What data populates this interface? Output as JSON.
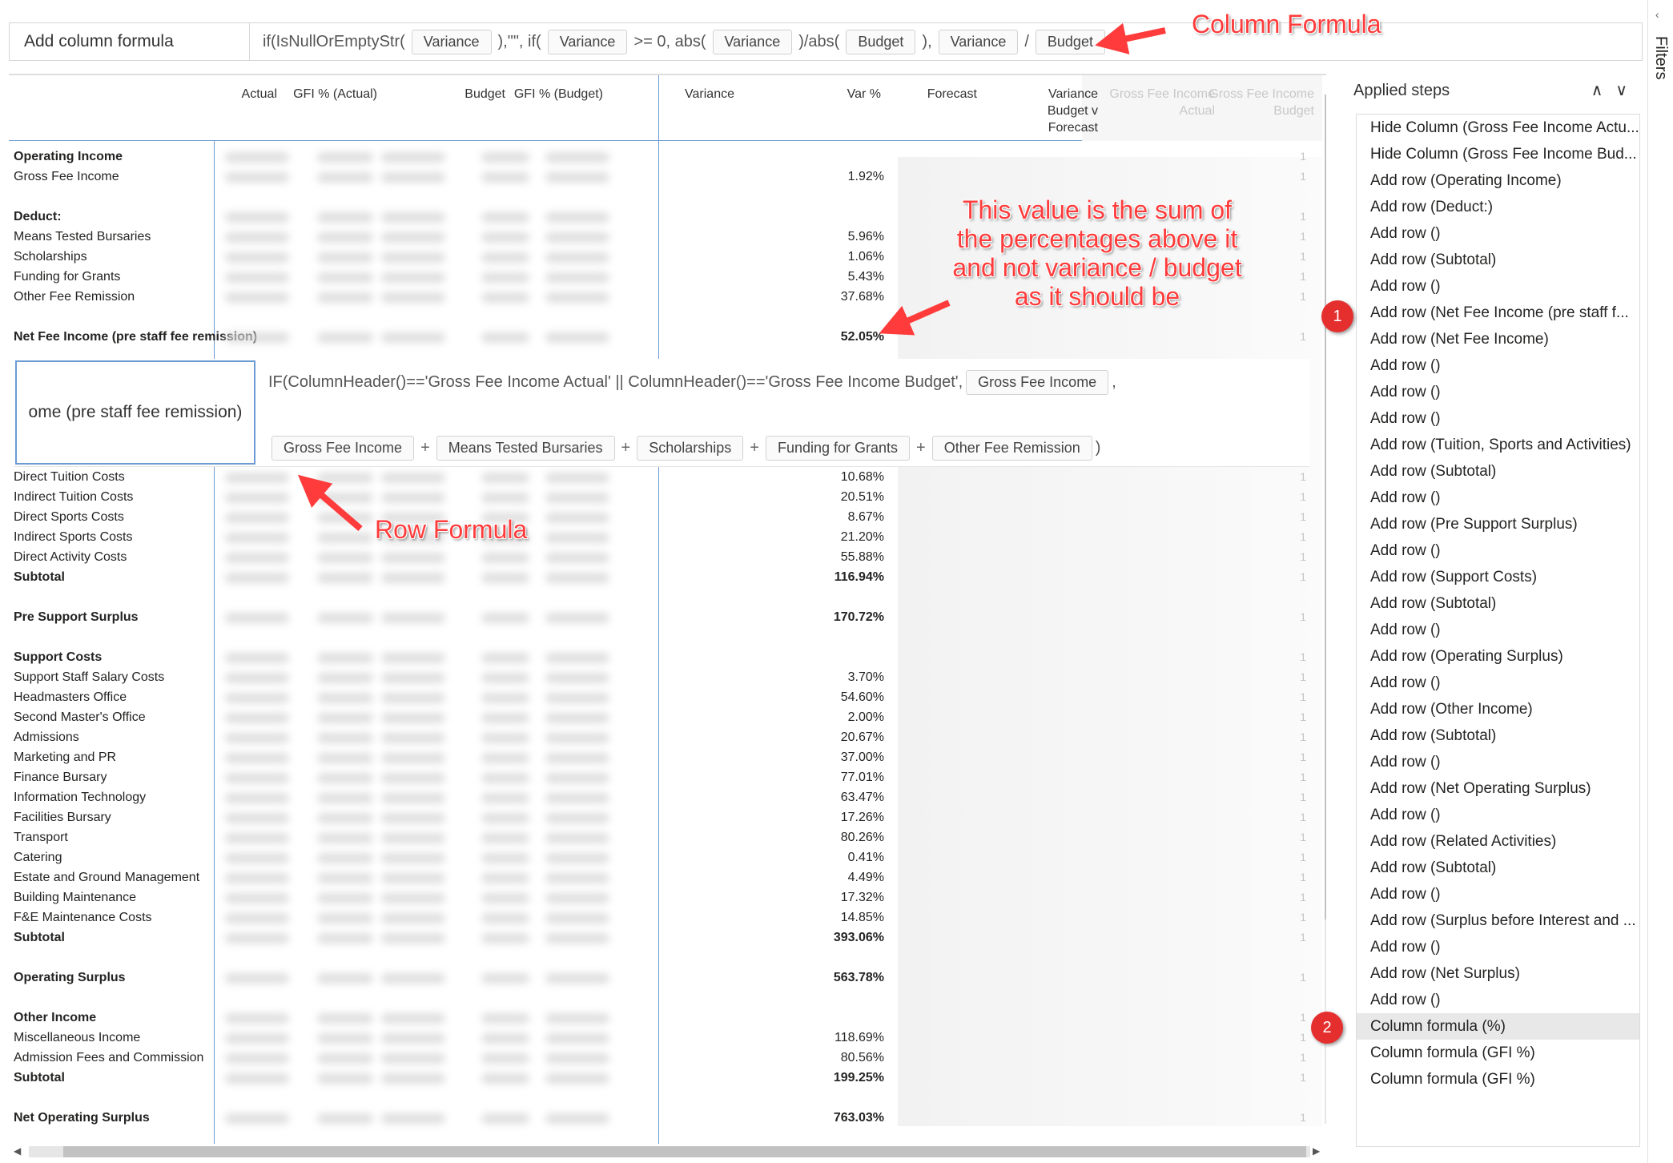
{
  "column_formula": {
    "label": "Add column formula",
    "parts": [
      {
        "t": "text",
        "v": "if(IsNullOrEmptyStr("
      },
      {
        "t": "chip",
        "v": "Variance"
      },
      {
        "t": "text",
        "v": "),\"\", if("
      },
      {
        "t": "chip",
        "v": "Variance"
      },
      {
        "t": "text",
        "v": ">= 0, abs("
      },
      {
        "t": "chip",
        "v": "Variance"
      },
      {
        "t": "text",
        "v": ")/abs("
      },
      {
        "t": "chip",
        "v": "Budget"
      },
      {
        "t": "text",
        "v": "),"
      },
      {
        "t": "chip",
        "v": "Variance"
      },
      {
        "t": "text",
        "v": "/"
      },
      {
        "t": "chip",
        "v": "Budget"
      },
      {
        "t": "text",
        "v": "))"
      }
    ]
  },
  "columns": [
    {
      "label": "Actual",
      "faded": false
    },
    {
      "label": "GFI % (Actual)",
      "faded": false
    },
    {
      "label": "Budget",
      "faded": false
    },
    {
      "label": "GFI % (Budget)",
      "faded": false
    },
    {
      "label": "Variance",
      "faded": false
    },
    {
      "label": "Var %",
      "faded": false
    },
    {
      "label": "Forecast",
      "faded": false
    },
    {
      "label": "Variance\nBudget v\nForecast",
      "faded": false
    },
    {
      "label": "Gross Fee Income\nActual",
      "faded": true
    },
    {
      "label": "Gross Fee Income\nBudget",
      "faded": true
    }
  ],
  "rows": [
    {
      "label": "Operating Income",
      "value": "",
      "bold": true
    },
    {
      "label": "Gross Fee Income",
      "value": "1.92%",
      "bold": false
    },
    {
      "label": "",
      "value": "",
      "bold": false
    },
    {
      "label": "Deduct:",
      "value": "",
      "bold": true
    },
    {
      "label": "Means Tested Bursaries",
      "value": "5.96%",
      "bold": false
    },
    {
      "label": "Scholarships",
      "value": "1.06%",
      "bold": false
    },
    {
      "label": "Funding for Grants",
      "value": "5.43%",
      "bold": false
    },
    {
      "label": "Other Fee Remission",
      "value": "37.68%",
      "bold": false
    },
    {
      "label": "",
      "value": "",
      "bold": false
    },
    {
      "label": "Net Fee Income (pre staff fee remission)",
      "value": "52.05%",
      "bold": true
    },
    {
      "label": "",
      "value": "",
      "bold": false
    },
    {
      "label": "",
      "value": "",
      "bold": false
    },
    {
      "label": "",
      "value": "",
      "bold": false
    },
    {
      "label": "",
      "value": "",
      "bold": false
    },
    {
      "label": "",
      "value": "",
      "bold": false
    },
    {
      "label": "",
      "value": "",
      "bold": false
    },
    {
      "label": "Direct Tuition Costs",
      "value": "10.68%",
      "bold": false
    },
    {
      "label": "Indirect Tuition Costs",
      "value": "20.51%",
      "bold": false
    },
    {
      "label": "Direct Sports Costs",
      "value": "8.67%",
      "bold": false
    },
    {
      "label": "Indirect Sports Costs",
      "value": "21.20%",
      "bold": false
    },
    {
      "label": "Direct Activity Costs",
      "value": "55.88%",
      "bold": false
    },
    {
      "label": "Subtotal",
      "value": "116.94%",
      "bold": true
    },
    {
      "label": "",
      "value": "",
      "bold": false
    },
    {
      "label": "Pre Support Surplus",
      "value": "170.72%",
      "bold": true
    },
    {
      "label": "",
      "value": "",
      "bold": false
    },
    {
      "label": "Support Costs",
      "value": "",
      "bold": true
    },
    {
      "label": "Support Staff Salary Costs",
      "value": "3.70%",
      "bold": false
    },
    {
      "label": "Headmasters Office",
      "value": "54.60%",
      "bold": false
    },
    {
      "label": "Second Master's Office",
      "value": "2.00%",
      "bold": false
    },
    {
      "label": "Admissions",
      "value": "20.67%",
      "bold": false
    },
    {
      "label": "Marketing and PR",
      "value": "37.00%",
      "bold": false
    },
    {
      "label": "Finance Bursary",
      "value": "77.01%",
      "bold": false
    },
    {
      "label": "Information Technology",
      "value": "63.47%",
      "bold": false
    },
    {
      "label": "Facilities Bursary",
      "value": "17.26%",
      "bold": false
    },
    {
      "label": "Transport",
      "value": "80.26%",
      "bold": false
    },
    {
      "label": "Catering",
      "value": "0.41%",
      "bold": false
    },
    {
      "label": "Estate and Ground Management",
      "value": "4.49%",
      "bold": false
    },
    {
      "label": "Building Maintenance",
      "value": "17.32%",
      "bold": false
    },
    {
      "label": "F&E Maintenance Costs",
      "value": "14.85%",
      "bold": false
    },
    {
      "label": "Subtotal",
      "value": "393.06%",
      "bold": true
    },
    {
      "label": "",
      "value": "",
      "bold": false
    },
    {
      "label": "Operating Surplus",
      "value": "563.78%",
      "bold": true
    },
    {
      "label": "",
      "value": "",
      "bold": false
    },
    {
      "label": "Other Income",
      "value": "",
      "bold": true
    },
    {
      "label": "Miscellaneous Income",
      "value": "118.69%",
      "bold": false
    },
    {
      "label": "Admission Fees and Commission",
      "value": "80.56%",
      "bold": false
    },
    {
      "label": "Subtotal",
      "value": "199.25%",
      "bold": true
    },
    {
      "label": "",
      "value": "",
      "bold": false
    },
    {
      "label": "Net Operating Surplus",
      "value": "763.03%",
      "bold": true
    }
  ],
  "row_marker": "1",
  "row_formula": {
    "name": "ome (pre staff fee remission)",
    "line1_text": "IF(ColumnHeader()=='Gross Fee Income Actual' || ColumnHeader()=='Gross Fee Income Budget',",
    "line1_chip": "Gross Fee Income",
    "line1_tail": ",",
    "line2": [
      {
        "t": "chip",
        "v": "Gross Fee Income"
      },
      {
        "t": "plus",
        "v": "+"
      },
      {
        "t": "chip",
        "v": "Means Tested Bursaries"
      },
      {
        "t": "plus",
        "v": "+"
      },
      {
        "t": "chip",
        "v": "Scholarships"
      },
      {
        "t": "plus",
        "v": "+"
      },
      {
        "t": "chip",
        "v": "Funding for Grants"
      },
      {
        "t": "plus",
        "v": "+"
      },
      {
        "t": "chip",
        "v": "Other Fee Remission"
      },
      {
        "t": "text",
        "v": ")"
      }
    ]
  },
  "steps": {
    "title": "Applied steps",
    "up": "∧",
    "down": "∨",
    "items": [
      "Hide Column (Gross Fee Income Actu...",
      "Hide Column (Gross Fee Income Bud...",
      "Add row (Operating Income)",
      "Add row (Deduct:)",
      "Add row ()",
      "Add row (Subtotal)",
      "Add row ()",
      "Add row (Net Fee Income (pre staff f...",
      "Add row (Net Fee Income)",
      "Add row ()",
      "Add row ()",
      "Add row ()",
      "Add row (Tuition, Sports and Activities)",
      "Add row (Subtotal)",
      "Add row ()",
      "Add row (Pre Support Surplus)",
      "Add row ()",
      "Add row (Support Costs)",
      "Add row (Subtotal)",
      "Add row ()",
      "Add row (Operating Surplus)",
      "Add row ()",
      "Add row (Other Income)",
      "Add row (Subtotal)",
      "Add row ()",
      "Add row (Net Operating Surplus)",
      "Add row ()",
      "Add row (Related Activities)",
      "Add row (Subtotal)",
      "Add row ()",
      "Add row (Surplus before Interest and ...",
      "Add row ()",
      "Add row (Net Surplus)",
      "Add row ()",
      "Column formula (%)",
      "Column formula (GFI %)",
      "Column formula (GFI %)"
    ],
    "selected_index": 34
  },
  "filters_label": "Filters",
  "annotations": {
    "column_formula": "Column Formula",
    "row_formula": "Row Formula",
    "note": "This value is the sum of\nthe percentages above it\nand not variance / budget\nas it should be",
    "badge1": "1",
    "badge2": "2",
    "color": "#ff3b3b"
  }
}
